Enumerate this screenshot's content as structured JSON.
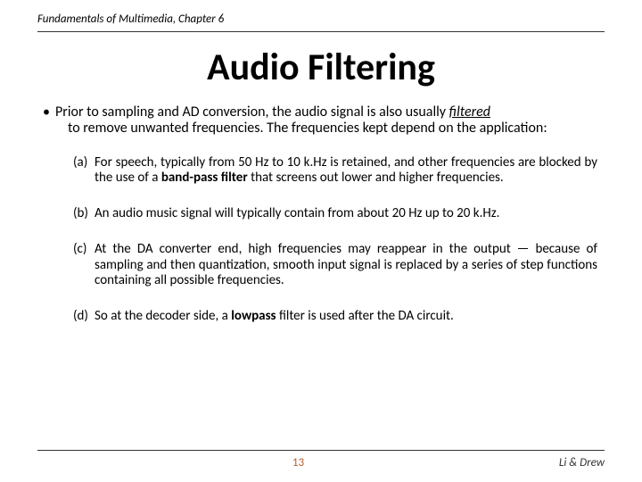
{
  "header": {
    "text": "Fundamentals of Multimedia, Chapter 6"
  },
  "title": "Audio Filtering",
  "intro": {
    "lead": "• ",
    "line1": "Prior to sampling and AD conversion, the audio signal is also usually ",
    "filtered_word": "filtered",
    "line2": "to remove unwanted frequencies. The frequencies kept depend on the application:"
  },
  "items": [
    {
      "label": "(a)",
      "pre": "For speech, typically from 50 Hz to 10 k.Hz is retained, and other frequencies are blocked by the use of a ",
      "bold": "band-pass filter",
      "post": " that screens out lower and higher frequencies."
    },
    {
      "label": "(b)",
      "pre": "An audio music signal will typically contain from about 20 Hz up to 20 k.Hz.",
      "bold": "",
      "post": ""
    },
    {
      "label": "(c)",
      "pre": "At the DA converter end, high frequencies may reappear in the output — because of sampling and then quantization, smooth input signal is replaced by a series of step functions containing all possible frequencies.",
      "bold": "",
      "post": ""
    },
    {
      "label": "(d)",
      "pre": "So at the decoder side, a ",
      "bold": "lowpass",
      "post": " filter is used after the DA circuit."
    }
  ],
  "footer": {
    "page": "13",
    "authors": "Li & Drew"
  }
}
